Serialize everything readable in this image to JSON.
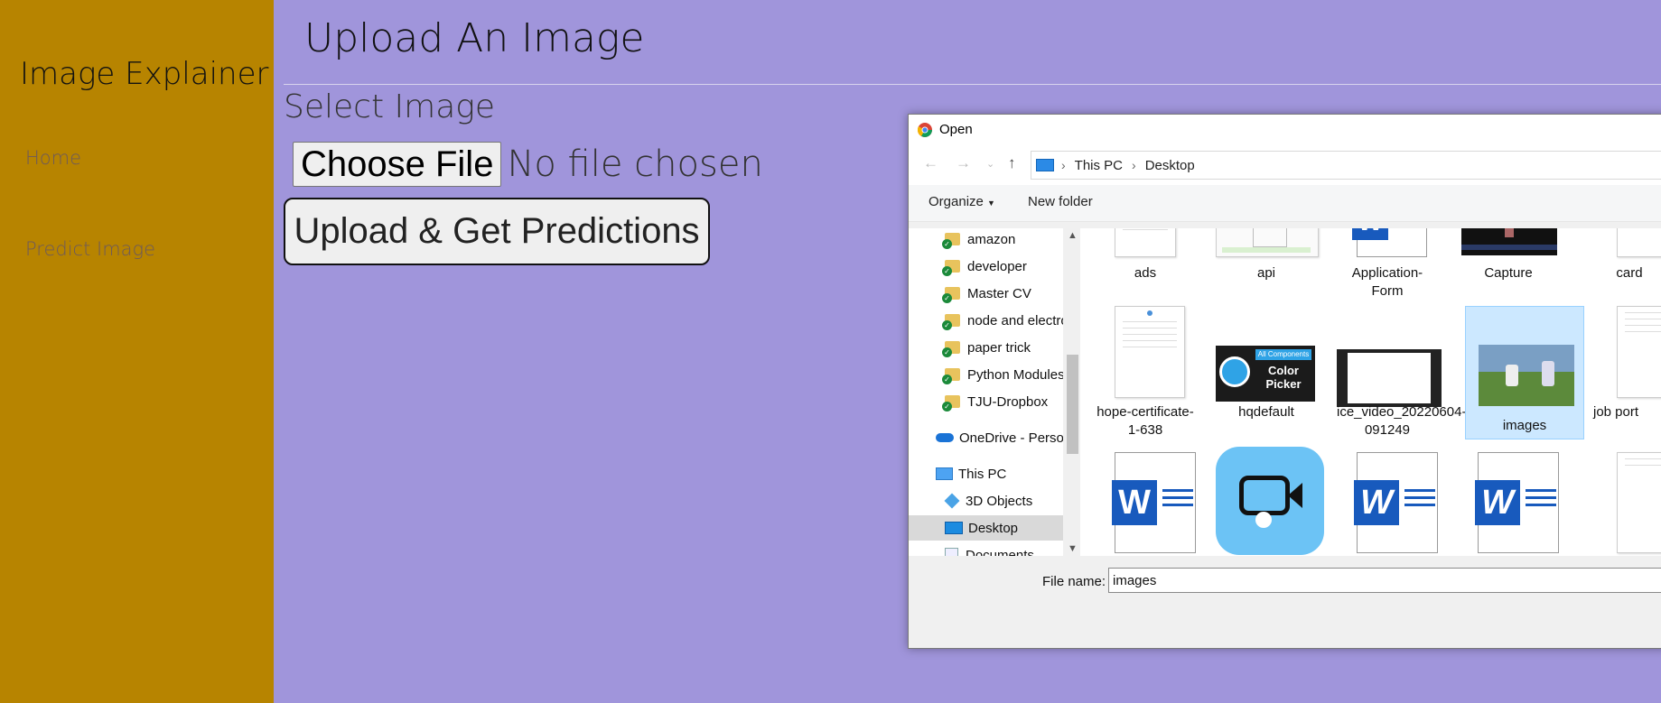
{
  "sidebar": {
    "brand": "Image Explainer",
    "links": [
      "Home",
      "Predict Image"
    ]
  },
  "main": {
    "title": "Upload An Image",
    "select_label": "Select Image",
    "choose_file_label": "Choose File",
    "no_file_text": "No file chosen",
    "upload_button": "Upload & Get Predictions"
  },
  "dialog": {
    "title": "Open",
    "breadcrumb": [
      "This PC",
      "Desktop"
    ],
    "toolbar": {
      "organize": "Organize",
      "new_folder": "New folder"
    },
    "nav_items": [
      "amazon",
      "developer",
      "Master CV",
      "node and electro",
      "paper trick",
      "Python Modules",
      "TJU-Dropbox",
      "OneDrive - Person",
      "This PC",
      "3D Objects",
      "Desktop",
      "Documents"
    ],
    "files_row1": [
      "ads",
      "api",
      "Application-Form",
      "Capture",
      "card"
    ],
    "files_row2": [
      "hope-certificate-1-638",
      "hqdefault",
      "ice_video_20220604-091249",
      "images",
      "job port"
    ],
    "thumb_text": {
      "hq_top": "All Components",
      "hq_main": "Color\nPicker"
    },
    "file_name_label": "File name:",
    "file_name_value": "images"
  },
  "colors": {
    "sidebar_bg": "#b78400",
    "main_bg": "#a095db",
    "selection": "#cce8ff"
  }
}
